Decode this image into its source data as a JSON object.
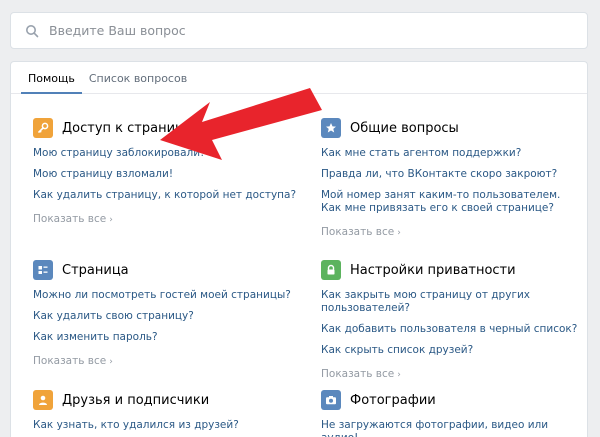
{
  "search": {
    "placeholder": "Введите Ваш вопрос"
  },
  "tabs": [
    {
      "label": "Помощь",
      "active": true
    },
    {
      "label": "Список вопросов",
      "active": false
    }
  ],
  "show_all_label": "Показать все",
  "sections": [
    {
      "title": "Доступ к странице",
      "icon": "key-icon",
      "color": "#f0a33a",
      "links": [
        "Мою страницу заблокировали!",
        "Мою страницу взломали!",
        "Как удалить страницу, к которой нет доступа?"
      ]
    },
    {
      "title": "Общие вопросы",
      "icon": "star-icon",
      "color": "#5b88bd",
      "links": [
        "Как мне стать агентом поддержки?",
        "Правда ли, что ВКонтакте скоро закроют?",
        "Мой номер занят каким-то пользователем. Как мне привязать его к своей странице?"
      ]
    },
    {
      "title": "Страница",
      "icon": "profile-card-icon",
      "color": "#5b88bd",
      "links": [
        "Можно ли посмотреть гостей моей страницы?",
        "Как удалить свою страницу?",
        "Как изменить пароль?"
      ]
    },
    {
      "title": "Настройки приватности",
      "icon": "lock-icon",
      "color": "#5cb35e",
      "links": [
        "Как закрыть мою страницу от других пользователей?",
        "Как добавить пользователя в черный список?",
        "Как скрыть список друзей?"
      ]
    },
    {
      "title": "Друзья и подписчики",
      "icon": "person-icon",
      "color": "#f0a33a",
      "links": [
        "Как узнать, кто удалился из друзей?"
      ]
    },
    {
      "title": "Фотографии",
      "icon": "camera-icon",
      "color": "#5b88bd",
      "links": [
        "Не загружаются фотографии, видео или аудио!"
      ]
    }
  ],
  "colors": {
    "link": "#2a5885",
    "accent": "#5181b8",
    "arrow": "#e8242c"
  }
}
